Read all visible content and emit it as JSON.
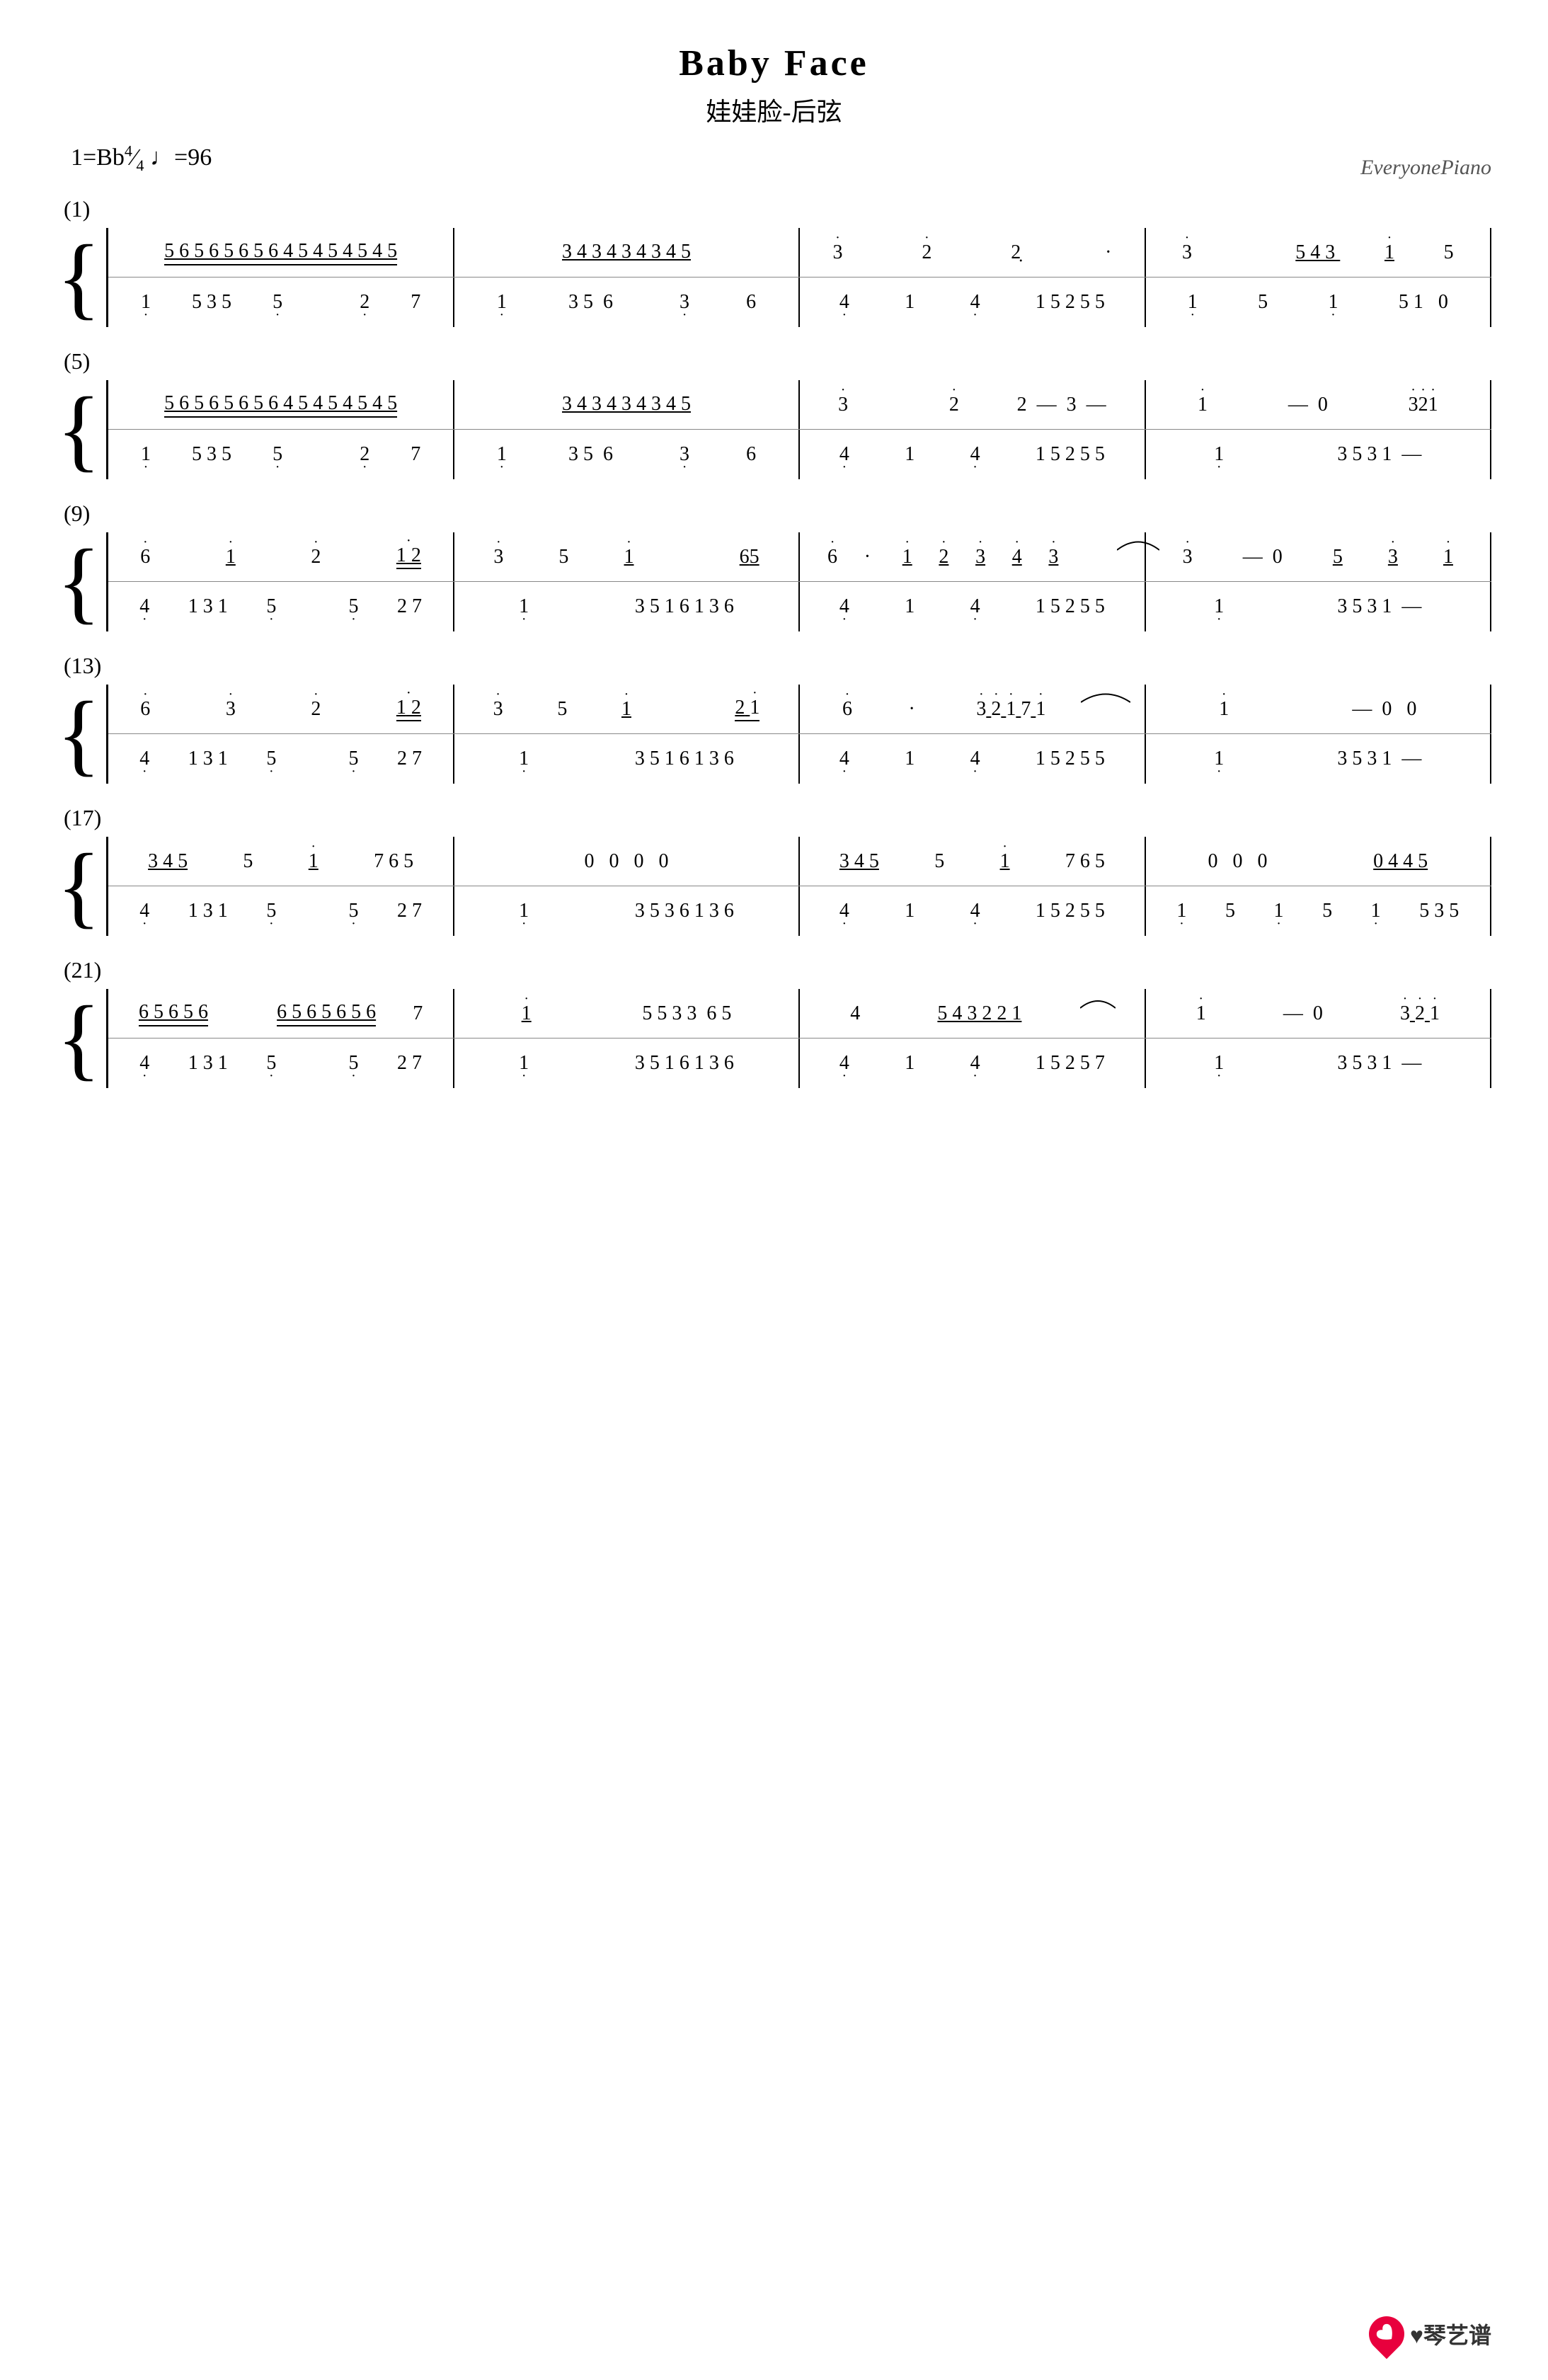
{
  "title": "Baby Face",
  "subtitle": "娃娃脸-后弦",
  "tempo": "1=Bb",
  "time_sig": "4/4",
  "bpm": "♩=96",
  "watermark": "EveryonePiano",
  "sections": [
    {
      "label": "(1)"
    },
    {
      "label": "(5)"
    },
    {
      "label": "(9)"
    },
    {
      "label": "(13)"
    },
    {
      "label": "(17)"
    },
    {
      "label": "(21)"
    }
  ],
  "logo": "♥琴艺谱"
}
